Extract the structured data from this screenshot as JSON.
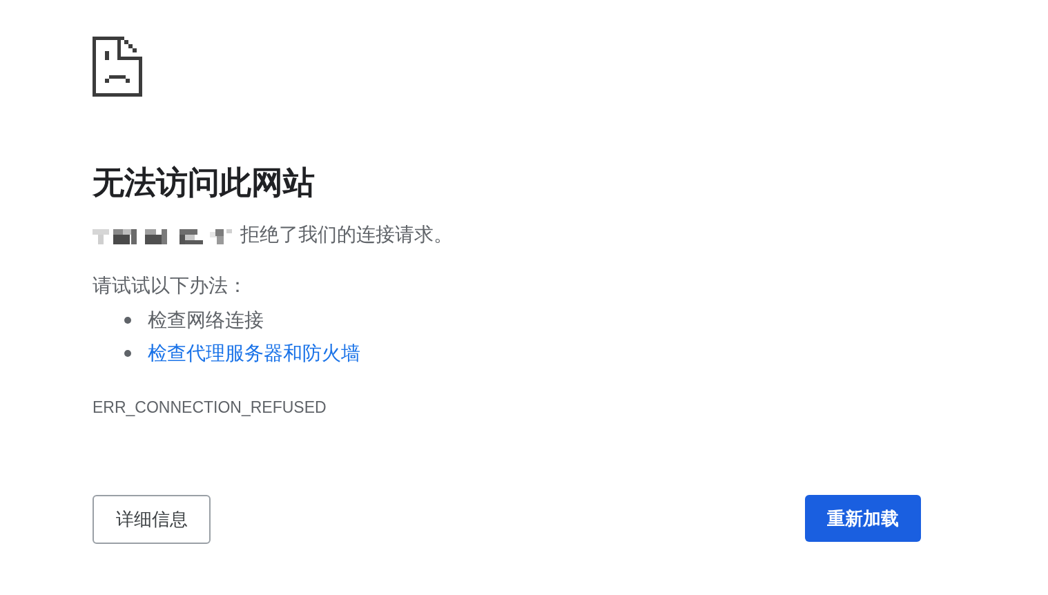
{
  "title": "无法访问此网站",
  "message": {
    "host": {
      "kind": "pixelated"
    },
    "text": "拒绝了我们的连接请求。"
  },
  "suggestions": {
    "heading": "请试试以下办法：",
    "items": [
      {
        "kind": "text",
        "text": "检查网络连接"
      },
      {
        "kind": "link",
        "text": "检查代理服务器和防火墙"
      }
    ]
  },
  "error_code": "ERR_CONNECTION_REFUSED",
  "buttons": {
    "details": "详细信息",
    "reload": "重新加载"
  }
}
